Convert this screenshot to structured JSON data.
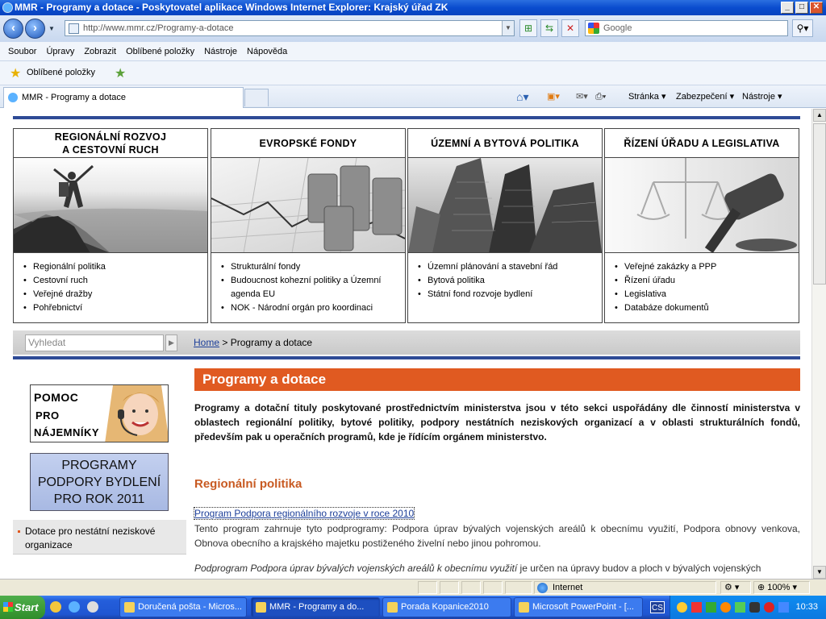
{
  "window": {
    "title": "MMR - Programy a dotace - Poskytovatel aplikace Windows Internet Explorer: Krajský úřad ZK",
    "minimize": "_",
    "maximize": "□",
    "close": "✕"
  },
  "address_bar": {
    "url": "http://www.mmr.cz/Programy-a-dotace",
    "search_placeholder": "Google"
  },
  "menu": [
    "Soubor",
    "Úpravy",
    "Zobrazit",
    "Oblíbené položky",
    "Nástroje",
    "Nápověda"
  ],
  "favorites": {
    "label": "Oblíbené položky"
  },
  "tab": {
    "title": "MMR - Programy a dotace"
  },
  "toolbar": {
    "page": "Stránka ▾",
    "security": "Zabezpečení ▾",
    "tools": "Nástroje ▾"
  },
  "categories": [
    {
      "title1": "REGIONÁLNÍ ROZVOJ",
      "title2": "A CESTOVNÍ RUCH",
      "items": [
        "Regionální politika",
        "Cestovní ruch",
        "Veřejné dražby",
        "Pohřebnictví"
      ]
    },
    {
      "title1": "EVROPSKÉ FONDY",
      "title2": "",
      "items": [
        "Strukturální fondy",
        "Budoucnost kohezní politiky a Územní agenda EU",
        "NOK - Národní orgán pro koordinaci"
      ]
    },
    {
      "title1": "ÚZEMNÍ A BYTOVÁ POLITIKA",
      "title2": "",
      "items": [
        "Územní plánování a stavební řád",
        "Bytová politika",
        "Státní fond rozvoje bydlení"
      ]
    },
    {
      "title1": "ŘÍZENÍ ÚŘADU A LEGISLATIVA",
      "title2": "",
      "items": [
        "Veřejné zakázky a PPP",
        "Řízení úřadu",
        "Legislativa",
        "Databáze dokumentů"
      ]
    }
  ],
  "search": {
    "placeholder": "Vyhledat"
  },
  "breadcrumb": {
    "home": "Home",
    "separator": ">",
    "current": "Programy a dotace"
  },
  "sidebar": {
    "banner1": {
      "line1": "POMOC",
      "line2": "PRO",
      "line3": "NÁJEMNÍKY"
    },
    "banner2": {
      "line1": "PROGRAMY",
      "line2": "PODPORY BYDLENÍ",
      "line3": "PRO ROK 2011"
    },
    "nav_item": "Dotace pro nestátní neziskové organizace"
  },
  "main": {
    "title": "Programy a dotace",
    "intro": "Programy a dotační tituly poskytované prostřednictvím ministerstva jsou v této sekci uspořádány dle činností ministerstva v oblastech regionální politiky, bytové politiky, podpory nestátních neziskových organizací a v oblasti strukturálních fondů, především pak u operačních programů, kde je řídícím orgánem ministerstvo.",
    "section_title": "Regionální politika",
    "link": "Program Podpora regionálního rozvoje v roce 2010",
    "paragraph1": "Tento program zahrnuje tyto podprogramy: Podpora úprav bývalých vojenských areálů k obecnímu využití, Podpora obnovy venkova, Obnova obecního a krajského majetku postiženého živelní nebo jinou pohromou.",
    "paragraph2_italic": "Podprogram Podpora úprav bývalých vojenských areálů k obecnímu využití",
    "paragraph2_rest": " je určen na úpravy budov a ploch v bývalých vojenských"
  },
  "status_bar": {
    "zone": "Internet",
    "zoom": "100%"
  },
  "taskbar": {
    "start": "Start",
    "tasks": [
      "Doručená pošta - Micros...",
      "MMR - Programy a do...",
      "Porada Kopanice2010",
      "Microsoft PowerPoint - [..."
    ],
    "clock": "10:33",
    "lang": "CS"
  },
  "colors": {
    "accent_orange": "#e05a21",
    "nav_blue": "#2e4b96",
    "title_blue": "#0a4ccf"
  }
}
